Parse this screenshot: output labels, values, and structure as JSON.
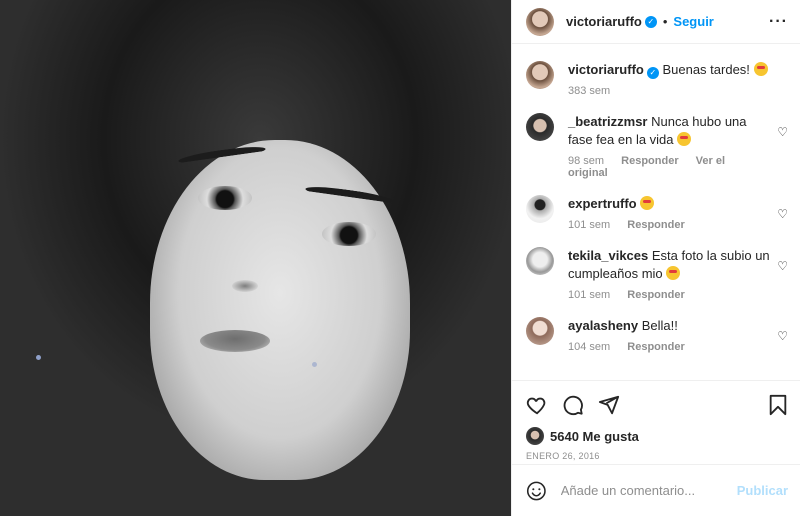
{
  "post": {
    "author": "victoriaruffo",
    "follow_label": "Seguir",
    "separator": "•",
    "more_label": "···"
  },
  "caption": {
    "user": "victoriaruffo",
    "text": "Buenas tardes!",
    "time": "383 sem"
  },
  "comments": [
    {
      "user": "_beatrizzmsr",
      "text": "Nunca hubo una fase fea en la vida",
      "time": "98 sem",
      "reply": "Responder",
      "extra": "Ver el original"
    },
    {
      "user": "expertruffo",
      "text": "",
      "time": "101 sem",
      "reply": "Responder"
    },
    {
      "user": "tekila_vikces",
      "text": "Esta foto la subio un cumpleaños mio",
      "time": "101 sem",
      "reply": "Responder"
    },
    {
      "user": "ayalasheny",
      "text": "Bella!!",
      "time": "104 sem",
      "reply": "Responder"
    }
  ],
  "actions": {
    "likes_label": "5640 Me gusta",
    "date": "ENERO 26, 2016"
  },
  "composer": {
    "placeholder": "Añade un comentario...",
    "publish_label": "Publicar"
  },
  "colors": {
    "accent": "#0095f6",
    "muted": "#8e8e8e",
    "publish_disabled": "#b2dffc"
  },
  "icons": [
    "heart-icon",
    "comment-icon",
    "share-icon",
    "bookmark-icon",
    "smile-icon",
    "verified-icon",
    "more-icon"
  ]
}
